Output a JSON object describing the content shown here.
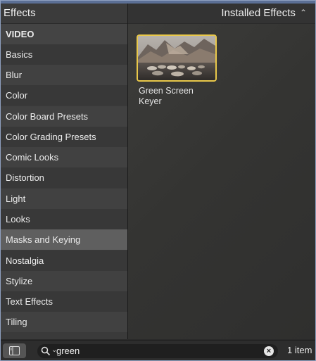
{
  "header": {
    "left_title": "Effects",
    "right_title": "Installed Effects",
    "right_chevron": "⌃⌄"
  },
  "sidebar": {
    "items": [
      {
        "label": "VIDEO",
        "kind": "heading"
      },
      {
        "label": "Basics"
      },
      {
        "label": "Blur"
      },
      {
        "label": "Color"
      },
      {
        "label": "Color Board Presets"
      },
      {
        "label": "Color Grading Presets"
      },
      {
        "label": "Comic Looks"
      },
      {
        "label": "Distortion"
      },
      {
        "label": "Light"
      },
      {
        "label": "Looks"
      },
      {
        "label": "Masks and Keying",
        "selected": true
      },
      {
        "label": "Nostalgia"
      },
      {
        "label": "Stylize"
      },
      {
        "label": "Text Effects"
      },
      {
        "label": "Tiling"
      }
    ]
  },
  "content": {
    "effects": [
      {
        "name_line1": "Green Screen",
        "name_line2": "Keyer",
        "icon": "landscape-thumbnail",
        "selected": true
      }
    ]
  },
  "bottom_bar": {
    "search_value": "green",
    "item_count": "1 item"
  },
  "colors": {
    "selection_border": "#e9c84a",
    "selected_sidebar": "#5f5f5f"
  }
}
